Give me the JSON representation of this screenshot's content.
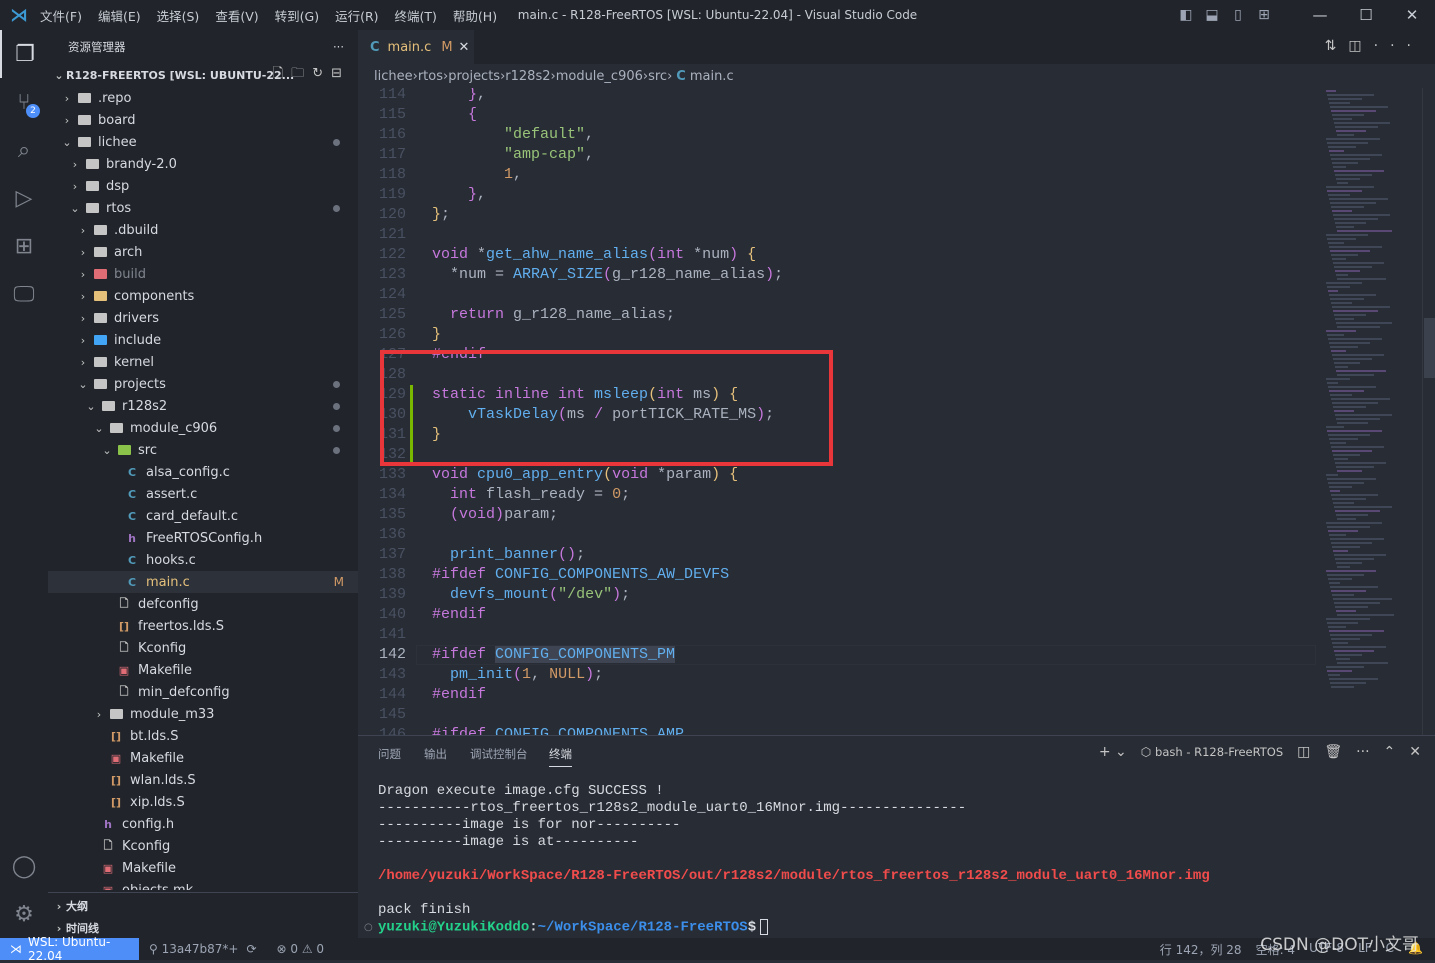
{
  "titlebar": {
    "menus": [
      "文件(F)",
      "编辑(E)",
      "选择(S)",
      "查看(V)",
      "转到(G)",
      "运行(R)",
      "终端(T)",
      "帮助(H)"
    ],
    "title": "main.c - R128-FreeRTOS [WSL: Ubuntu-22.04] - Visual Studio Code"
  },
  "activity": {
    "scm_badge": "2"
  },
  "explorer": {
    "header": "资源管理器",
    "workspace": "R128-FREERTOS [WSL: UBUNTU-22...",
    "items": [
      {
        "d": 0,
        "t": "folder",
        "name": ".repo"
      },
      {
        "d": 0,
        "t": "folder",
        "name": "board"
      },
      {
        "d": 0,
        "t": "open",
        "name": "lichee",
        "dot": true
      },
      {
        "d": 1,
        "t": "folder",
        "name": "brandy-2.0"
      },
      {
        "d": 1,
        "t": "folder",
        "name": "dsp"
      },
      {
        "d": 1,
        "t": "open",
        "name": "rtos",
        "dot": true
      },
      {
        "d": 2,
        "t": "folder",
        "name": ".dbuild"
      },
      {
        "d": 2,
        "t": "folder",
        "name": "arch"
      },
      {
        "d": 2,
        "t": "folder",
        "name": "build",
        "dim": true
      },
      {
        "d": 2,
        "t": "folder",
        "name": "components"
      },
      {
        "d": 2,
        "t": "folder",
        "name": "drivers"
      },
      {
        "d": 2,
        "t": "folder",
        "name": "include"
      },
      {
        "d": 2,
        "t": "folder",
        "name": "kernel"
      },
      {
        "d": 2,
        "t": "open",
        "name": "projects",
        "dot": true
      },
      {
        "d": 3,
        "t": "open",
        "name": "r128s2",
        "dot": true
      },
      {
        "d": 4,
        "t": "open",
        "name": "module_c906",
        "dot": true
      },
      {
        "d": 5,
        "t": "open",
        "name": "src",
        "dot": true
      },
      {
        "d": 6,
        "t": "c",
        "name": "alsa_config.c"
      },
      {
        "d": 6,
        "t": "c",
        "name": "assert.c"
      },
      {
        "d": 6,
        "t": "c",
        "name": "card_default.c"
      },
      {
        "d": 6,
        "t": "h",
        "name": "FreeRTOSConfig.h"
      },
      {
        "d": 6,
        "t": "c",
        "name": "hooks.c"
      },
      {
        "d": 6,
        "t": "c",
        "name": "main.c",
        "badge": "M",
        "sel": true
      },
      {
        "d": 5,
        "t": "file",
        "name": "defconfig"
      },
      {
        "d": 5,
        "t": "ld",
        "name": "freertos.lds.S"
      },
      {
        "d": 5,
        "t": "file",
        "name": "Kconfig"
      },
      {
        "d": 5,
        "t": "mk",
        "name": "Makefile"
      },
      {
        "d": 5,
        "t": "file",
        "name": "min_defconfig"
      },
      {
        "d": 4,
        "t": "folder",
        "name": "module_m33"
      },
      {
        "d": 4,
        "t": "ld",
        "name": "bt.lds.S"
      },
      {
        "d": 4,
        "t": "mk",
        "name": "Makefile"
      },
      {
        "d": 4,
        "t": "ld",
        "name": "wlan.lds.S"
      },
      {
        "d": 4,
        "t": "ld",
        "name": "xip.lds.S"
      },
      {
        "d": 3,
        "t": "h",
        "name": "config.h"
      },
      {
        "d": 3,
        "t": "file",
        "name": "Kconfig"
      },
      {
        "d": 3,
        "t": "mk",
        "name": "Makefile"
      },
      {
        "d": 3,
        "t": "mk",
        "name": "objects.mk"
      }
    ],
    "outline": "大纲",
    "timeline": "时间线"
  },
  "tab": {
    "name": "main.c",
    "badge": "M",
    "icon": "C"
  },
  "breadcrumb": [
    "lichee",
    "rtos",
    "projects",
    "r128s2",
    "module_c906",
    "src",
    "main.c"
  ],
  "editor": {
    "current_line": 142,
    "lines": [
      {
        "n": 114,
        "t": [
          [
            "p",
            "    "
          ],
          [
            "b2",
            "}"
          ],
          [
            "p",
            ","
          ]
        ]
      },
      {
        "n": 115,
        "t": [
          [
            "p",
            "    "
          ],
          [
            "b2",
            "{"
          ]
        ]
      },
      {
        "n": 116,
        "t": [
          [
            "p",
            "        "
          ],
          [
            "s",
            "\"default\""
          ],
          [
            "p",
            ","
          ]
        ]
      },
      {
        "n": 117,
        "t": [
          [
            "p",
            "        "
          ],
          [
            "s",
            "\"amp-cap\""
          ],
          [
            "p",
            ","
          ]
        ]
      },
      {
        "n": 118,
        "t": [
          [
            "p",
            "        "
          ],
          [
            "n",
            "1"
          ],
          [
            "p",
            ","
          ]
        ]
      },
      {
        "n": 119,
        "t": [
          [
            "p",
            "    "
          ],
          [
            "b2",
            "}"
          ],
          [
            "p",
            ","
          ]
        ]
      },
      {
        "n": 120,
        "t": [
          [
            "b",
            "}"
          ],
          [
            "p",
            ";"
          ]
        ]
      },
      {
        "n": 121,
        "t": []
      },
      {
        "n": 122,
        "t": [
          [
            "k",
            "void"
          ],
          [
            "p",
            " *"
          ],
          [
            "f",
            "get_ahw_name_alias"
          ],
          [
            "b2",
            "("
          ],
          [
            "k",
            "int"
          ],
          [
            "p",
            " *num"
          ],
          [
            "b2",
            ")"
          ],
          [
            "p",
            " "
          ],
          [
            "b",
            "{"
          ]
        ]
      },
      {
        "n": 123,
        "t": [
          [
            "p",
            "  *num = "
          ],
          [
            "f",
            "ARRAY_SIZE"
          ],
          [
            "b2",
            "("
          ],
          [
            "p",
            "g_r128_name_alias"
          ],
          [
            "b2",
            ")"
          ],
          [
            "p",
            ";"
          ]
        ]
      },
      {
        "n": 124,
        "t": []
      },
      {
        "n": 125,
        "t": [
          [
            "p",
            "  "
          ],
          [
            "k",
            "return"
          ],
          [
            "p",
            " g_r128_name_alias;"
          ]
        ]
      },
      {
        "n": 126,
        "t": [
          [
            "b",
            "}"
          ]
        ]
      },
      {
        "n": 127,
        "t": [
          [
            "k",
            "#endif"
          ]
        ]
      },
      {
        "n": 128,
        "t": []
      },
      {
        "n": 129,
        "t": [
          [
            "k",
            "static inline int"
          ],
          [
            "p",
            " "
          ],
          [
            "f",
            "msleep"
          ],
          [
            "b",
            "("
          ],
          [
            "k",
            "int"
          ],
          [
            "p",
            " ms"
          ],
          [
            "b",
            ")"
          ],
          [
            "p",
            " "
          ],
          [
            "b",
            "{"
          ]
        ]
      },
      {
        "n": 130,
        "t": [
          [
            "p",
            "    "
          ],
          [
            "f",
            "vTaskDelay"
          ],
          [
            "b2",
            "("
          ],
          [
            "p",
            "ms "
          ],
          [
            "k",
            "/"
          ],
          [
            "p",
            " portTICK_RATE_MS"
          ],
          [
            "b2",
            ")"
          ],
          [
            "p",
            ";"
          ]
        ]
      },
      {
        "n": 131,
        "t": [
          [
            "b",
            "}"
          ]
        ]
      },
      {
        "n": 132,
        "t": []
      },
      {
        "n": 133,
        "t": [
          [
            "k",
            "void"
          ],
          [
            "p",
            " "
          ],
          [
            "f",
            "cpu0_app_entry"
          ],
          [
            "b",
            "("
          ],
          [
            "k",
            "void"
          ],
          [
            "p",
            " *param"
          ],
          [
            "b",
            ")"
          ],
          [
            "p",
            " "
          ],
          [
            "b",
            "{"
          ]
        ]
      },
      {
        "n": 134,
        "t": [
          [
            "p",
            "  "
          ],
          [
            "k",
            "int"
          ],
          [
            "p",
            " flash_ready = "
          ],
          [
            "n",
            "0"
          ],
          [
            "p",
            ";"
          ]
        ]
      },
      {
        "n": 135,
        "t": [
          [
            "p",
            "  "
          ],
          [
            "b2",
            "("
          ],
          [
            "k",
            "void"
          ],
          [
            "b2",
            ")"
          ],
          [
            "p",
            "param;"
          ]
        ]
      },
      {
        "n": 136,
        "t": []
      },
      {
        "n": 137,
        "t": [
          [
            "p",
            "  "
          ],
          [
            "f",
            "print_banner"
          ],
          [
            "b2",
            "()"
          ],
          [
            "p",
            ";"
          ]
        ]
      },
      {
        "n": 138,
        "t": [
          [
            "k",
            "#ifdef"
          ],
          [
            "p",
            " "
          ],
          [
            "f",
            "CONFIG_COMPONENTS_AW_DEVFS"
          ]
        ]
      },
      {
        "n": 139,
        "t": [
          [
            "p",
            "  "
          ],
          [
            "f",
            "devfs_mount"
          ],
          [
            "b2",
            "("
          ],
          [
            "s",
            "\"/dev\""
          ],
          [
            "b2",
            ")"
          ],
          [
            "p",
            ";"
          ]
        ]
      },
      {
        "n": 140,
        "t": [
          [
            "k",
            "#endif"
          ]
        ]
      },
      {
        "n": 141,
        "t": []
      },
      {
        "n": 142,
        "t": [
          [
            "k",
            "#ifdef"
          ],
          [
            "p",
            " "
          ],
          [
            "h",
            "CONFIG_COMPONENTS_PM"
          ]
        ]
      },
      {
        "n": 143,
        "t": [
          [
            "p",
            "  "
          ],
          [
            "f",
            "pm_init"
          ],
          [
            "b2",
            "("
          ],
          [
            "n",
            "1"
          ],
          [
            "p",
            ", "
          ],
          [
            "n",
            "NULL"
          ],
          [
            "b2",
            ")"
          ],
          [
            "p",
            ";"
          ]
        ]
      },
      {
        "n": 144,
        "t": [
          [
            "k",
            "#endif"
          ]
        ]
      },
      {
        "n": 145,
        "t": []
      },
      {
        "n": 146,
        "t": [
          [
            "k",
            "#ifdef"
          ],
          [
            "p",
            " "
          ],
          [
            "f",
            "CONFIG_COMPONENTS_AMP"
          ]
        ]
      }
    ]
  },
  "panel": {
    "tabs": [
      "问题",
      "输出",
      "调试控制台",
      "终端"
    ],
    "active_tab": "终端",
    "terminal_name": "bash - R128-FreeRTOS",
    "lines": [
      {
        "c": "#d7dae0",
        "t": "Dragon execute image.cfg SUCCESS !"
      },
      {
        "c": "#d7dae0",
        "t": "-----------rtos_freertos_r128s2_module_uart0_16Mnor.img---------------"
      },
      {
        "c": "#d7dae0",
        "t": "----------image is for nor----------"
      },
      {
        "c": "#d7dae0",
        "t": "----------image is at----------"
      },
      {
        "c": "#d7dae0",
        "t": ""
      },
      {
        "c": "#f14c4c",
        "t": "/home/yuzuki/WorkSpace/R128-FreeRTOS/out/r128s2/module/rtos_freertos_r128s2_module_uart0_16Mnor.img"
      },
      {
        "c": "#d7dae0",
        "t": ""
      },
      {
        "c": "#d7dae0",
        "t": "pack finish"
      }
    ],
    "prompt_user": "yuzuki@YuzukiKoddo",
    "prompt_path": "~/WorkSpace/R128-FreeRTOS",
    "prompt_end": "$"
  },
  "status": {
    "remote": "WSL: Ubuntu-22.04",
    "branch": "13a47b87*+",
    "errors": "0",
    "warnings": "0",
    "position": "行 142，列 28",
    "spaces": "空格: 4",
    "encoding": "UTF-8",
    "eol": "LF",
    "lang": "C"
  },
  "watermark": "CSDN @DOT小文哥",
  "colors": {
    "accent": "#4d8ef8",
    "highlight_box": "#e8363a",
    "modified": "#d19a66"
  }
}
